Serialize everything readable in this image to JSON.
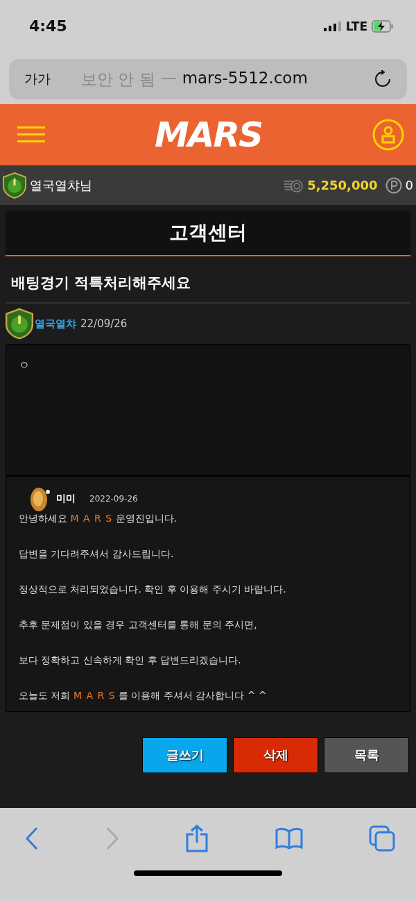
{
  "status_bar": {
    "time": "4:45",
    "network": "LTE"
  },
  "address_bar": {
    "text_size": "가가",
    "security": "보안 안 됨",
    "separator": "—",
    "domain": "mars-5512.com"
  },
  "header": {
    "logo": "MARS"
  },
  "user_bar": {
    "username": "열국열챠님",
    "balance": "5,250,000",
    "points": "0"
  },
  "page_title": "고객센터",
  "post": {
    "title": "배팅경기 적특처리해주세요",
    "author": "열국열챠",
    "date": "22/09/26",
    "body": "ㅇ"
  },
  "reply": {
    "author": "미미",
    "date": "2022-09-26",
    "lines": [
      [
        {
          "text": "안녕하세요 ",
          "highlight": false
        },
        {
          "text": "M A R S",
          "highlight": true
        },
        {
          "text": " 운영진입니다.",
          "highlight": false
        }
      ],
      [
        {
          "text": "답변을 기다려주셔서 감사드립니다.",
          "highlight": false
        }
      ],
      [
        {
          "text": "정상적으로 처리되었습니다. 확인 후 이용해 주시기 바랍니다.",
          "highlight": false
        }
      ],
      [
        {
          "text": "추후 문제점이 있을 경우 고객센터를 통해 문의 주시면,",
          "highlight": false
        }
      ],
      [
        {
          "text": "보다 정확하고 신속하게 확인 후 답변드리겠습니다.",
          "highlight": false
        }
      ],
      [
        {
          "text": "오늘도 저희 ",
          "highlight": false
        },
        {
          "text": "M A R S",
          "highlight": true
        },
        {
          "text": " 를 이용해 주셔서 감사합니다 ^ ^",
          "highlight": false
        }
      ]
    ]
  },
  "buttons": [
    {
      "label": "글쓰기",
      "kind": "write"
    },
    {
      "label": "삭제",
      "kind": "delete"
    },
    {
      "label": "목록",
      "kind": "list"
    }
  ],
  "toolbar": {
    "forward_disabled": true
  }
}
